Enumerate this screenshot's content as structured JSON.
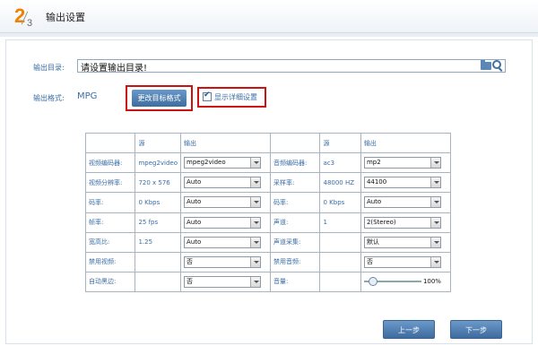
{
  "header": {
    "step_current": "2",
    "step_total": "3",
    "title": "输出设置"
  },
  "output_dir": {
    "label": "输出目录:",
    "value": "请设置输出目录!"
  },
  "output_format": {
    "label": "输出格式:",
    "value": "MPG",
    "change_button": "更改目标格式",
    "detail_checkbox": "显示详细设置",
    "detail_checked": true
  },
  "table": {
    "header": {
      "src": "源",
      "out": "输出"
    },
    "video": [
      {
        "name": "视频编码器:",
        "src": "mpeg2video",
        "out": "mpeg2video",
        "kind": "select"
      },
      {
        "name": "视频分辨率:",
        "src": "720 x 576",
        "out": "Auto",
        "kind": "select"
      },
      {
        "name": "码率:",
        "src": "0 Kbps",
        "out": "Auto",
        "kind": "select"
      },
      {
        "name": "帧率:",
        "src": "25 fps",
        "out": "Auto",
        "kind": "select"
      },
      {
        "name": "宽高比:",
        "src": "1.25",
        "out": "Auto",
        "kind": "select"
      },
      {
        "name": "禁用视频:",
        "src": "",
        "out": "否",
        "kind": "select"
      },
      {
        "name": "自动黑边:",
        "src": "",
        "out": "否",
        "kind": "select"
      }
    ],
    "audio": [
      {
        "name": "音频编码器:",
        "src": "ac3",
        "out": "mp2",
        "kind": "select"
      },
      {
        "name": "采样率:",
        "src": "48000 HZ",
        "out": "44100",
        "kind": "select"
      },
      {
        "name": "码率:",
        "src": "0 Kbps",
        "out": "Auto",
        "kind": "select"
      },
      {
        "name": "声道:",
        "src": "1",
        "out": "2(Stereo)",
        "kind": "select"
      },
      {
        "name": "声道采集:",
        "src": "",
        "out": "默认",
        "kind": "select"
      },
      {
        "name": "禁用音频:",
        "src": "",
        "out": "否",
        "kind": "select"
      },
      {
        "name": "音量:",
        "src": "",
        "out": "100%",
        "kind": "slider",
        "level": 0.1
      }
    ]
  },
  "footer": {
    "prev": "上一步",
    "next": "下一步"
  }
}
